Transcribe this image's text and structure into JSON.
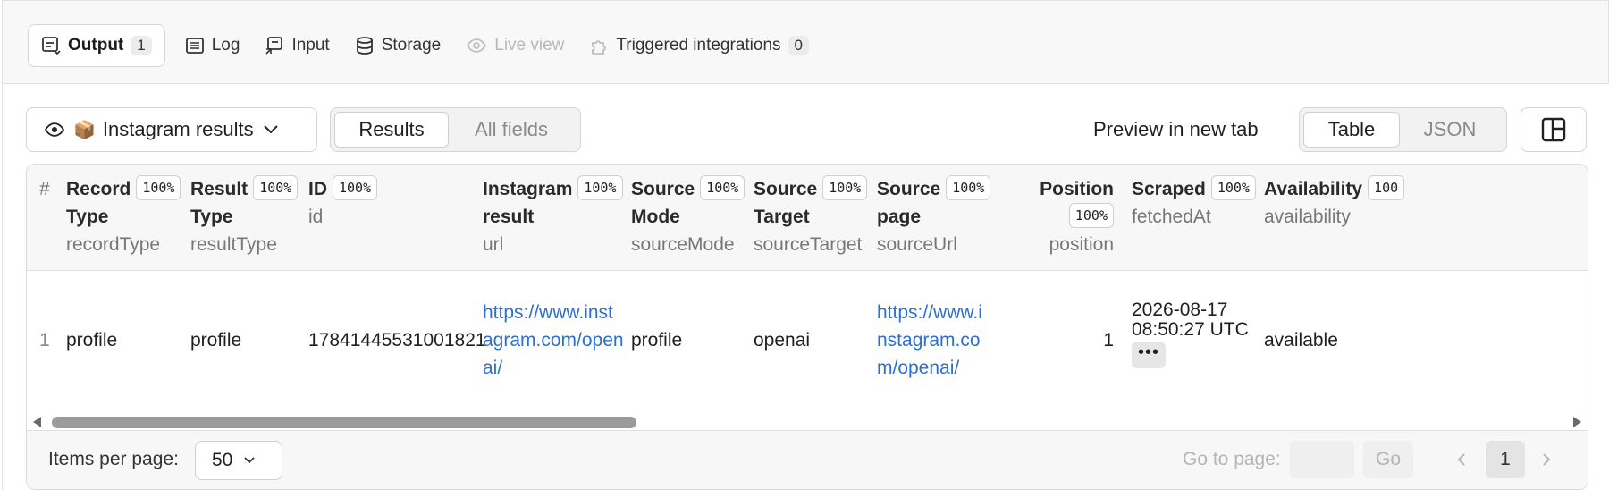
{
  "tabs": [
    {
      "label": "Output",
      "count": "1",
      "icon": "output-icon"
    },
    {
      "label": "Log",
      "icon": "log-icon"
    },
    {
      "label": "Input",
      "icon": "input-icon"
    },
    {
      "label": "Storage",
      "icon": "database-icon"
    },
    {
      "label": "Live view",
      "icon": "eye-signal-icon"
    },
    {
      "label": "Triggered integrations",
      "count": "0",
      "icon": "puzzle-icon"
    }
  ],
  "toolbar": {
    "dataset_label": "Instagram results",
    "dataset_emoji": "📦",
    "view_tabs": [
      "Results",
      "All fields"
    ],
    "preview_link": "Preview in new tab",
    "format_tabs": [
      "Table",
      "JSON"
    ]
  },
  "table": {
    "hash": "#",
    "columns": [
      {
        "title1": "Record",
        "title2": "Type",
        "pct": "100%",
        "key": "recordType"
      },
      {
        "title1": "Result",
        "title2": "Type",
        "pct": "100%",
        "key": "resultType"
      },
      {
        "title1": "ID",
        "title2": "",
        "pct": "100%",
        "key": "id"
      },
      {
        "title1": "Instagram",
        "title2": "result",
        "pct": "100%",
        "key": "url"
      },
      {
        "title1": "Source",
        "title2": "Mode",
        "pct": "100%",
        "key": "sourceMode"
      },
      {
        "title1": "Source",
        "title2": "Target",
        "pct": "100%",
        "key": "sourceTarget"
      },
      {
        "title1": "Source",
        "title2": "page",
        "pct": "100%",
        "key": "sourceUrl"
      },
      {
        "title1": "Position",
        "title2": "",
        "pct": "100%",
        "key": "position"
      },
      {
        "title1": "Scraped",
        "title2": "",
        "pct": "100%",
        "key": "fetchedAt"
      },
      {
        "title1": "Availability",
        "title2": "",
        "pct": "100",
        "key": "availability"
      }
    ],
    "rows": [
      {
        "num": "1",
        "recordType": "profile",
        "resultType": "profile",
        "id": "17841445531001821",
        "url_lines": [
          "https://www.inst",
          "agram.com/open",
          "ai/"
        ],
        "sourceMode": "profile",
        "sourceTarget": "openai",
        "sourceUrl_lines": [
          "https://www.i",
          "nstagram.co",
          "m/openai/"
        ],
        "position": "1",
        "fetchedAt_lines": [
          "2026-08-17",
          "08:50:27 UTC"
        ],
        "more": "•••",
        "availability": "available"
      }
    ]
  },
  "footer": {
    "items_per_page_label": "Items per page:",
    "items_per_page_value": "50",
    "goto_label": "Go to page:",
    "go_label": "Go",
    "current_page": "1"
  },
  "colors": {
    "link": "#2c6fd1",
    "accent_bg": "#f7f7f7"
  }
}
